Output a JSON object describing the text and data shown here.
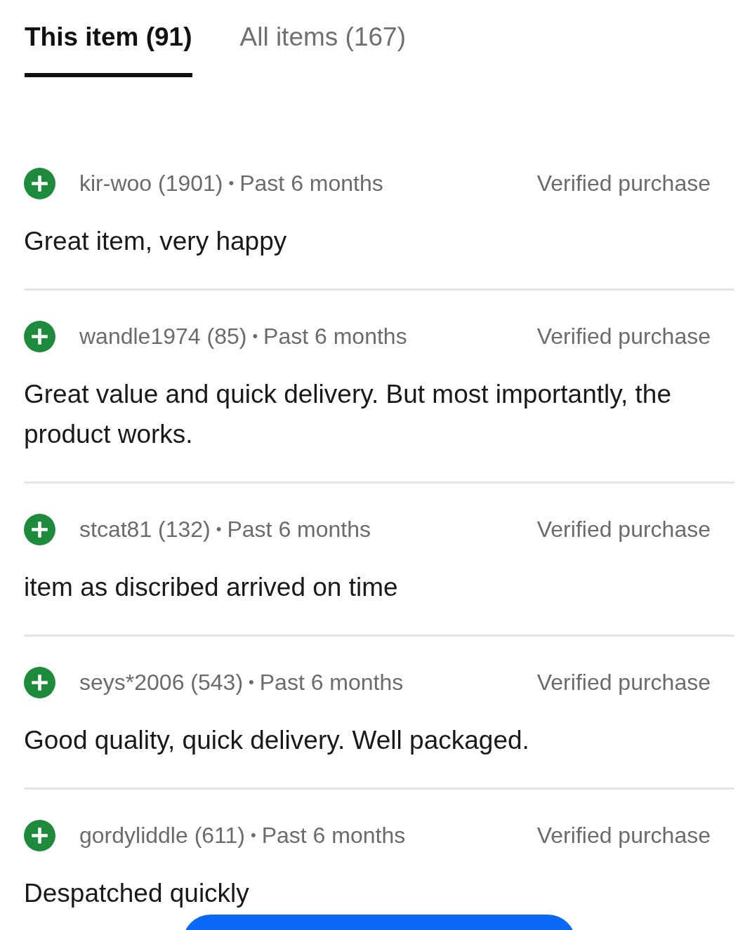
{
  "tabs": [
    {
      "label": "This item (91)",
      "selected": true
    },
    {
      "label": "All items (167)",
      "selected": false
    }
  ],
  "reviews": [
    {
      "kind": "positive",
      "user": "kir-woo (1901)",
      "separator": "•",
      "time": "Past 6 months",
      "badge": "Verified purchase",
      "comment": "Great item, very happy"
    },
    {
      "kind": "positive",
      "user": "wandle1974 (85)",
      "separator": "•",
      "time": "Past 6 months",
      "badge": "Verified purchase",
      "comment": "Great value and quick delivery. But most importantly, the product works."
    },
    {
      "kind": "positive",
      "user": "stcat81 (132)",
      "separator": "•",
      "time": "Past 6 months",
      "badge": "Verified purchase",
      "comment": "item as discribed arrived on time"
    },
    {
      "kind": "positive",
      "user": "seys*2006 (543)",
      "separator": "•",
      "time": "Past 6 months",
      "badge": "Verified purchase",
      "comment": "Good quality, quick delivery. Well packaged."
    },
    {
      "kind": "positive",
      "user": "gordyliddle (611)",
      "separator": "•",
      "time": "Past 6 months",
      "badge": "Verified purchase",
      "comment": "Despatched quickly"
    }
  ]
}
